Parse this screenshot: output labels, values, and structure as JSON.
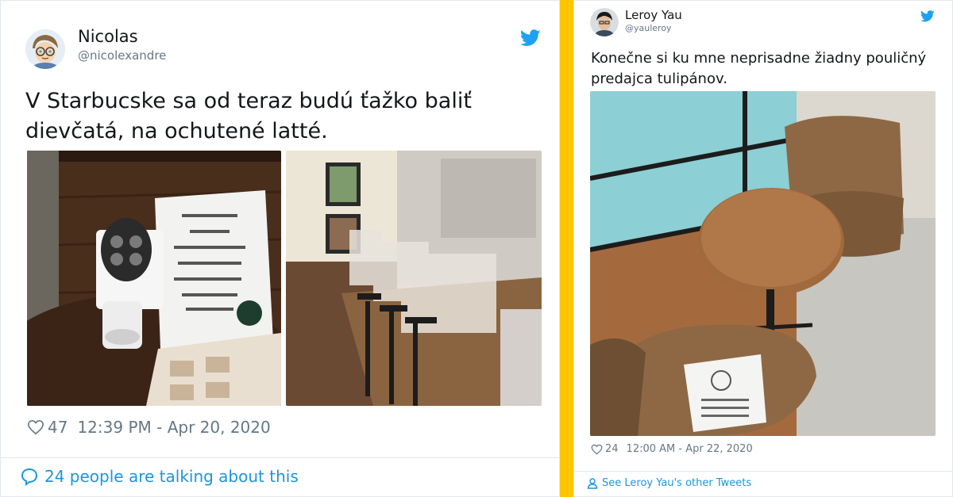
{
  "tweet1": {
    "author_name": "Nicolas",
    "author_handle": "@nicolexandre",
    "text_line1": "V Starbucske sa od teraz budú ťažko baliť",
    "text_line2": "dievčatá, na ochutené latté.",
    "likes": "47",
    "timestamp": "12:39 PM - Apr 20, 2020",
    "talking": "24 people are talking about this",
    "icons": {
      "brand": "twitter-bird-icon",
      "like": "heart-icon",
      "reply": "speech-bubble-icon"
    }
  },
  "tweet2": {
    "author_name": "Leroy Yau",
    "author_handle": "@yauleroy",
    "text_line1": "Konečne si ku mne neprisadne žiadny pouličný",
    "text_line2": "predajca tulipánov.",
    "likes": "24",
    "timestamp": "12:00 AM - Apr 22, 2020",
    "see_more": "See Leroy Yau's other Tweets",
    "icons": {
      "brand": "twitter-bird-icon",
      "like": "heart-icon",
      "user": "person-icon"
    }
  },
  "colors": {
    "accent": "#1da1f2",
    "link": "#1b95e0",
    "muted": "#657786",
    "separator": "#ffc600"
  }
}
